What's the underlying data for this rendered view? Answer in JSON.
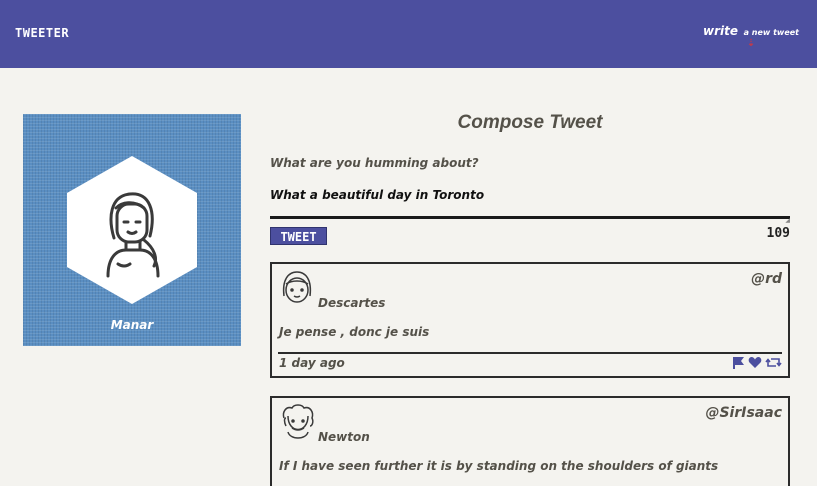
{
  "nav": {
    "brand": "TWEETER",
    "write_prefix": "write",
    "write_suffix": "a new tweet",
    "chevron": "⇣"
  },
  "profile": {
    "name": "Manar",
    "background_color": "#5a8ec2"
  },
  "composer": {
    "title": "Compose Tweet",
    "prompt": "What are you humming about?",
    "text": "What a beautiful day in Toronto",
    "button_label": "TWEET",
    "char_count": "109"
  },
  "tweets": [
    {
      "name": "Descartes",
      "handle": "@rd",
      "content": "Je pense , donc je suis",
      "time": "1 day ago",
      "actions": [
        "flag-icon",
        "heart-icon",
        "retweet-icon"
      ]
    },
    {
      "name": "Newton",
      "handle": "@SirIsaac",
      "content": "If I have seen further it is by standing on the shoulders of giants",
      "time": "",
      "actions": []
    }
  ],
  "colors": {
    "accent": "#4c4f9f",
    "background": "#f4f3ef",
    "text": "#545149",
    "chevron": "#c13a4b"
  }
}
